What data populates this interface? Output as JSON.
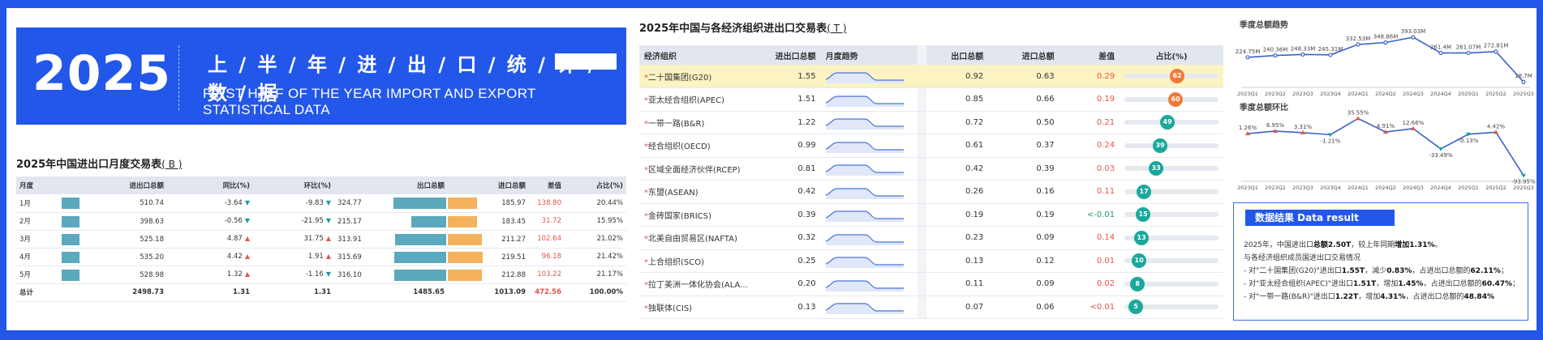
{
  "banner": {
    "year": "2025",
    "title_cn": "上 / 半 / 年 / 进 / 出 / 口 / 统 / 计 / 数 / 据",
    "title_en": "FIRST HALF OF THE YEAR IMPORT AND EXPORT STATISTICAL DATA"
  },
  "monthly": {
    "title": "2025年中国进出口月度交易表",
    "tag": "( B )",
    "headers": [
      "月度",
      "进出口总额",
      "同比(%)",
      "环比(%)",
      "出口总额",
      "进口总额",
      "差值",
      "占比(%)"
    ],
    "rows": [
      {
        "month": "1月",
        "total": "510.74",
        "yoy": "-3.64",
        "yoy_dir": "down",
        "mom": "-9.83",
        "mom_dir": "down",
        "export": "324.77",
        "import": "185.97",
        "diff": "138.80",
        "share": "20.44%",
        "export_frac": 0.86,
        "import_frac": 0.52
      },
      {
        "month": "2月",
        "total": "398.63",
        "yoy": "-0.56",
        "yoy_dir": "down",
        "mom": "-21.95",
        "mom_dir": "down",
        "export": "215.17",
        "import": "183.45",
        "diff": "31.72",
        "share": "15.95%",
        "export_frac": 0.57,
        "import_frac": 0.52
      },
      {
        "month": "3月",
        "total": "525.18",
        "yoy": "4.87",
        "yoy_dir": "up",
        "mom": "31.75",
        "mom_dir": "up",
        "export": "313.91",
        "import": "211.27",
        "diff": "102.64",
        "share": "21.02%",
        "export_frac": 0.83,
        "import_frac": 0.6
      },
      {
        "month": "4月",
        "total": "535.20",
        "yoy": "4.42",
        "yoy_dir": "up",
        "mom": "1.91",
        "mom_dir": "up",
        "export": "315.69",
        "import": "219.51",
        "diff": "96.18",
        "share": "21.42%",
        "export_frac": 0.84,
        "import_frac": 0.62
      },
      {
        "month": "5月",
        "total": "528.98",
        "yoy": "1.32",
        "yoy_dir": "up",
        "mom": "-1.16",
        "mom_dir": "down",
        "export": "316.10",
        "import": "212.88",
        "diff": "103.22",
        "share": "21.17%",
        "export_frac": 0.84,
        "import_frac": 0.6
      }
    ],
    "total_row": {
      "month": "总计",
      "total": "2498.73",
      "yoy": "1.31",
      "mom": "1.31",
      "export": "1485.65",
      "import": "1013.09",
      "diff": "472.56",
      "share": "100.00%"
    }
  },
  "orgs": {
    "title": "2025年中国与各经济组织进出口交易表",
    "tag": "( T )",
    "headers": [
      "经济组织",
      "进出口总额",
      "月度趋势",
      "出口总额",
      "进口总额",
      "差值",
      "占比(%)"
    ],
    "rows": [
      {
        "name": "二十国集团(G20)",
        "total": "1.55",
        "export": "0.92",
        "import": "0.63",
        "diff": "0.29",
        "diff_color": "red",
        "share": 62,
        "dot_color": "#f07a3a"
      },
      {
        "name": "亚太经合组织(APEC)",
        "total": "1.51",
        "export": "0.85",
        "import": "0.66",
        "diff": "0.19",
        "diff_color": "red",
        "share": 60,
        "dot_color": "#f07a3a"
      },
      {
        "name": "一带一路(B&R)",
        "total": "1.22",
        "export": "0.72",
        "import": "0.50",
        "diff": "0.21",
        "diff_color": "red",
        "share": 49,
        "dot_color": "#1aa89c"
      },
      {
        "name": "经合组织(OECD)",
        "total": "0.99",
        "export": "0.61",
        "import": "0.37",
        "diff": "0.24",
        "diff_color": "red",
        "share": 39,
        "dot_color": "#1aa89c"
      },
      {
        "name": "区域全面经济伙伴(RCEP)",
        "total": "0.81",
        "export": "0.42",
        "import": "0.39",
        "diff": "0.03",
        "diff_color": "red",
        "share": 33,
        "dot_color": "#1aa89c"
      },
      {
        "name": "东盟(ASEAN)",
        "total": "0.42",
        "export": "0.26",
        "import": "0.16",
        "diff": "0.11",
        "diff_color": "red",
        "share": 17,
        "dot_color": "#1aa89c"
      },
      {
        "name": "金砖国家(BRICS)",
        "total": "0.39",
        "export": "0.19",
        "import": "0.19",
        "diff": "<-0.01",
        "diff_color": "green",
        "share": 15,
        "dot_color": "#1aa89c"
      },
      {
        "name": "北美自由贸易区(NAFTA)",
        "total": "0.32",
        "export": "0.23",
        "import": "0.09",
        "diff": "0.14",
        "diff_color": "red",
        "share": 13,
        "dot_color": "#1aa89c"
      },
      {
        "name": "上合组织(SCO)",
        "total": "0.25",
        "export": "0.13",
        "import": "0.12",
        "diff": "0.01",
        "diff_color": "red",
        "share": 10,
        "dot_color": "#1aa89c"
      },
      {
        "name": "拉丁美洲一体化协会(ALA...",
        "total": "0.20",
        "export": "0.11",
        "import": "0.09",
        "diff": "0.02",
        "diff_color": "red",
        "share": 8,
        "dot_color": "#1aa89c"
      },
      {
        "name": "独联体(CIS)",
        "total": "0.13",
        "export": "0.07",
        "import": "0.06",
        "diff": "<0.01",
        "diff_color": "red",
        "share": 5,
        "dot_color": "#1aa89c"
      }
    ]
  },
  "chart_data": [
    {
      "type": "line",
      "title": "季度总额趋势",
      "categories": [
        "2023Q1",
        "2023Q2",
        "2023Q3",
        "2023Q4",
        "2024Q1",
        "2024Q2",
        "2024Q3",
        "2024Q4",
        "2025Q1",
        "2025Q2",
        "2025Q3"
      ],
      "values": [
        224.75,
        240.36,
        248.33,
        245.31,
        332.53,
        348.86,
        393.03,
        261.4,
        261.07,
        272.81,
        18.7
      ],
      "labels": [
        "224.75M",
        "240.36M",
        "248.33M",
        "245.31M",
        "332.53M",
        "348.86M",
        "393.03M",
        "261.4M",
        "261.07M",
        "272.81M",
        "18.7M"
      ],
      "color": "#3a63c9"
    },
    {
      "type": "line",
      "title": "季度总额环比",
      "categories": [
        "2023Q1",
        "2023Q2",
        "2023Q3",
        "2023Q4",
        "2024Q1",
        "2024Q2",
        "2024Q3",
        "2024Q4",
        "2025Q1",
        "2025Q2",
        "2025Q3"
      ],
      "values": [
        1.26,
        6.95,
        3.31,
        -1.21,
        35.55,
        4.91,
        12.66,
        -33.49,
        -0.13,
        4.42,
        -93.95
      ],
      "labels": [
        "1.26%",
        "6.95%",
        "3.31%",
        "-1.21%",
        "35.55%",
        "4.91%",
        "12.66%",
        "-33.49%",
        "-0.13%",
        "4.42%",
        "-93.95%"
      ],
      "color": "#3a63c9",
      "up_color": "#e2544a",
      "down_color": "#1aa89c"
    }
  ],
  "result": {
    "title": "数据结果   Data result",
    "l1a": "2025年，中国进出口",
    "l1b": "总额2.50T",
    "l1c": "，较上年同期",
    "l1d": "增加1.31%",
    "l1e": "。",
    "l2": "与各经济组织成员国进出口交易情况",
    "l3a": "- 对\"二十国集团(G20)\"进出口",
    "l3b": "1.55T",
    "l3c": "，减少",
    "l3d": "0.83%",
    "l3e": "，占进出口总额的",
    "l3f": "62.11%",
    "l3g": "；",
    "l4a": "- 对\"亚太经合组织(APEC)\"进出口",
    "l4b": "1.51T",
    "l4c": "，增加",
    "l4d": "1.45%",
    "l4e": "，占进出口总额的",
    "l4f": "60.47%",
    "l4g": "；",
    "l5a": "- 对\"一带一路(B&R)\"进出口",
    "l5b": "1.22T",
    "l5c": "，增加",
    "l5d": "4.31%",
    "l5e": "，占进出口总额的",
    "l5f": "48.84%"
  }
}
